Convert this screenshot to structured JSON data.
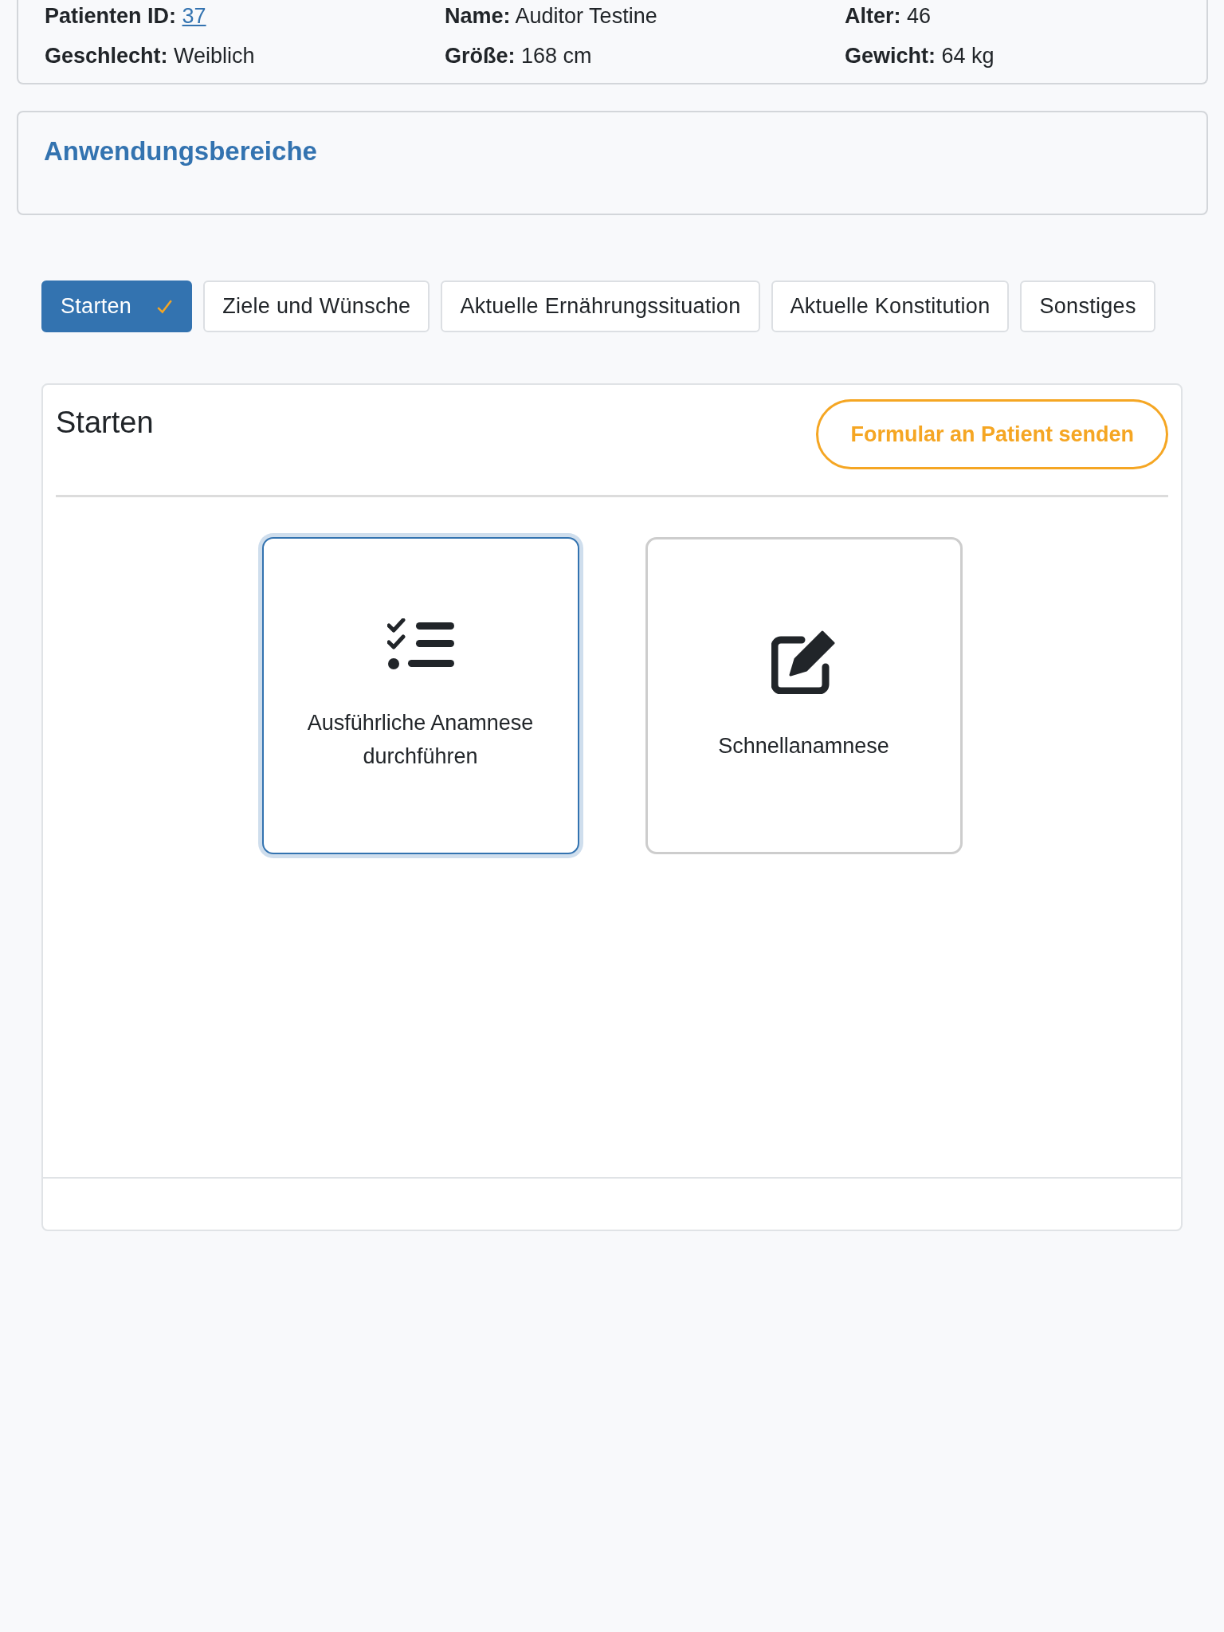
{
  "patient": {
    "fields": [
      {
        "label": "Patienten ID:",
        "value": "37",
        "kind": "link"
      },
      {
        "label": "Name:",
        "value": "Auditor Testine",
        "kind": "text"
      },
      {
        "label": "Alter:",
        "value": "46",
        "kind": "text"
      },
      {
        "label": "Geschlecht:",
        "value": "Weiblich",
        "kind": "text"
      },
      {
        "label": "Größe:",
        "value": "168 cm",
        "kind": "text"
      },
      {
        "label": "Gewicht:",
        "value": "64 kg",
        "kind": "text"
      }
    ]
  },
  "areas": {
    "title": "Anwendungsbereiche"
  },
  "tabs": [
    {
      "label": "Starten",
      "selected": true,
      "completed": true
    },
    {
      "label": "Ziele und Wünsche",
      "selected": false,
      "completed": false
    },
    {
      "label": "Aktuelle Ernährungssituation",
      "selected": false,
      "completed": false
    },
    {
      "label": "Aktuelle Konstitution",
      "selected": false,
      "completed": false
    },
    {
      "label": "Sonstiges",
      "selected": false,
      "completed": false
    }
  ],
  "panel": {
    "title": "Starten",
    "send_button": "Formular an Patient senden",
    "options": [
      {
        "label": "Ausführliche Anamnese durchführen",
        "kind": "checklist",
        "selected": true
      },
      {
        "label": "Schnellanamnese",
        "kind": "edit",
        "selected": false
      }
    ]
  }
}
